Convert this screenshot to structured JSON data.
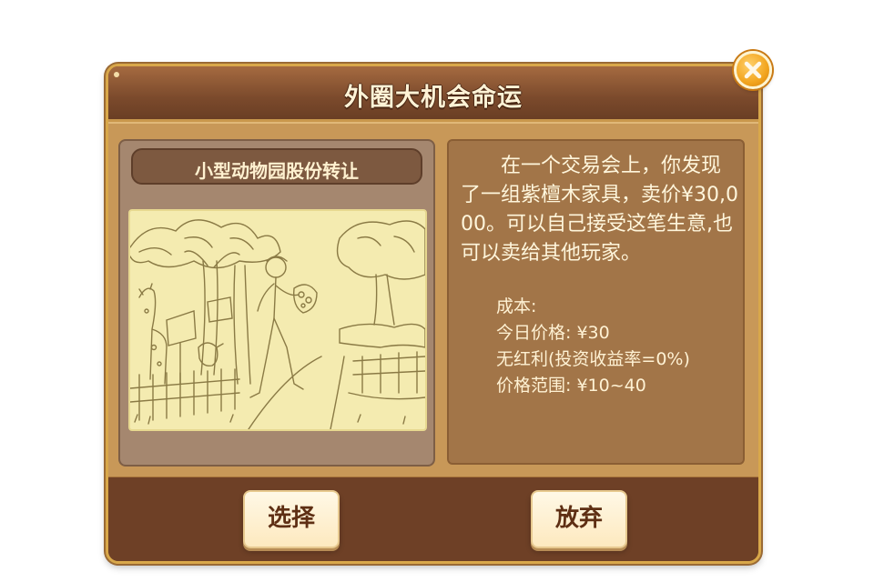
{
  "dialog": {
    "title": "外圈大机会命运"
  },
  "card": {
    "title": "小型动物园股份转让",
    "illustration_icon": "zoo-sketch-illustration"
  },
  "description": {
    "text": "在一个交易会上，你发现了一组紫檀木家具，卖价¥30,000。可以自己接受这笔生意,也可以卖给其他玩家。",
    "cost_label": "成本:",
    "price_today": "今日价格: ¥30",
    "dividend": "无红利(投资收益率=0%)",
    "price_range": "价格范围: ¥10~40"
  },
  "buttons": {
    "select_label": "选择",
    "abandon_label": "放弃",
    "close_icon": "close-icon"
  },
  "colors": {
    "frame": "#7a4a2c",
    "gold_border": "#d9a84a",
    "button_text": "#5e2f14",
    "close_orange": "#f2a51f"
  }
}
